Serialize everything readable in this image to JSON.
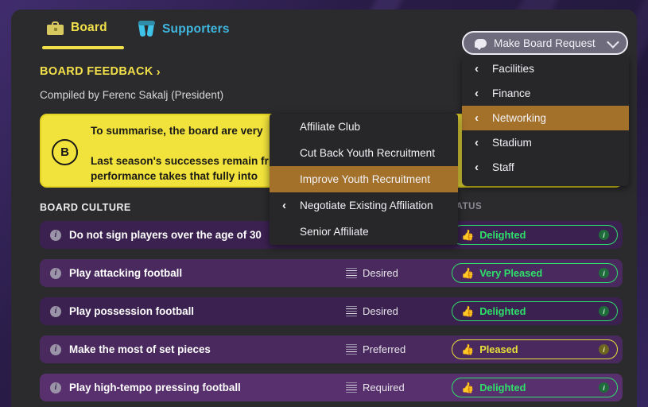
{
  "tabs": [
    {
      "label": "Board",
      "icon": "briefcase-icon",
      "active": true
    },
    {
      "label": "Supporters",
      "icon": "scarf-icon",
      "active": false
    }
  ],
  "header": {
    "feedback_title": "BOARD FEEDBACK",
    "feedback_chevron": "›",
    "compiled_by": "Compiled by Ferenc Sakalj (President)"
  },
  "feedback_card": {
    "badge": "B",
    "line1": "To summarise, the board are very",
    "line2": "Last season's successes remain fr",
    "line3": "performance takes that fully into"
  },
  "board_culture": {
    "section_title": "BOARD CULTURE",
    "status_column_header": "TATUS",
    "rows": [
      {
        "label": "Do not sign players over the age of 30",
        "importance": "",
        "status": "Delighted",
        "status_color": "green",
        "thumb": "👍"
      },
      {
        "label": "Play attacking football",
        "importance": "Desired",
        "status": "Very Pleased",
        "status_color": "green",
        "thumb": "👍"
      },
      {
        "label": "Play possession football",
        "importance": "Desired",
        "status": "Delighted",
        "status_color": "green",
        "thumb": "👍"
      },
      {
        "label": "Make the most of set pieces",
        "importance": "Preferred",
        "status": "Pleased",
        "status_color": "yellow",
        "thumb": "👍"
      },
      {
        "label": "Play high-tempo pressing football",
        "importance": "Required",
        "status": "Delighted",
        "status_color": "green",
        "thumb": "👍"
      }
    ]
  },
  "make_board_request": {
    "label": "Make Board Request",
    "icon": "speech-bubble-icon",
    "chevron": "chevron-down-icon",
    "menu": [
      {
        "label": "Facilities",
        "selected": false
      },
      {
        "label": "Finance",
        "selected": false
      },
      {
        "label": "Networking",
        "selected": true
      },
      {
        "label": "Stadium",
        "selected": false
      },
      {
        "label": "Staff",
        "selected": false
      }
    ],
    "submenu": [
      {
        "label": "Affiliate Club",
        "selected": false,
        "has_chevron": false
      },
      {
        "label": "Cut Back Youth Recruitment",
        "selected": false,
        "has_chevron": false
      },
      {
        "label": "Improve Youth Recruitment",
        "selected": true,
        "has_chevron": false
      },
      {
        "label": "Negotiate Existing Affiliation",
        "selected": false,
        "has_chevron": true
      },
      {
        "label": "Senior Affiliate",
        "selected": false,
        "has_chevron": false
      }
    ]
  },
  "colors": {
    "accent_yellow": "#f2e04a",
    "tab_blue": "#3fb7e0",
    "status_green": "#2ee06a",
    "status_yellow": "#e8e03a",
    "menu_highlight": "#a3712a",
    "row_purple": "#4a2a5e"
  }
}
